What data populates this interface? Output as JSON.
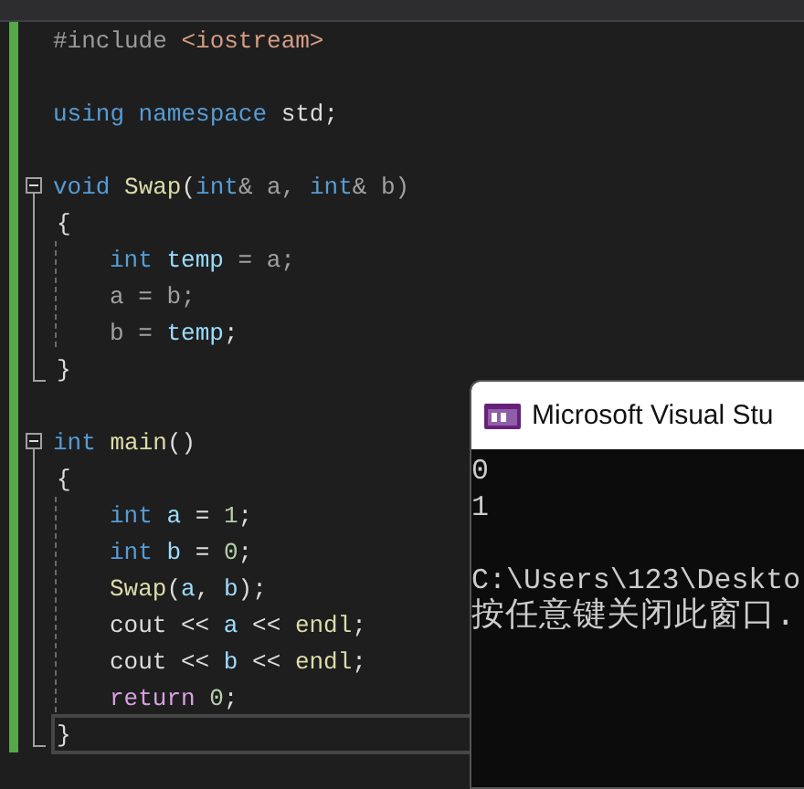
{
  "editor": {
    "lines": [
      {
        "kind": "plain",
        "current": false,
        "tokens": [
          {
            "text": "#include ",
            "kind": "preprocessor"
          },
          {
            "text": "<iostream>",
            "kind": "string"
          }
        ]
      },
      {
        "kind": "blank"
      },
      {
        "kind": "plain",
        "current": false,
        "tokens": [
          {
            "text": "using namespace ",
            "kind": "keyword"
          },
          {
            "text": "std;",
            "kind": "plain"
          }
        ]
      },
      {
        "kind": "blank"
      },
      {
        "kind": "fold",
        "current": false,
        "tokens": [
          {
            "text": "void ",
            "kind": "keyword"
          },
          {
            "text": "Swap",
            "kind": "function"
          },
          {
            "text": "(",
            "kind": "plain"
          },
          {
            "text": "int",
            "kind": "keyword"
          },
          {
            "text": "& a, ",
            "kind": "param"
          },
          {
            "text": "int",
            "kind": "keyword"
          },
          {
            "text": "& b)",
            "kind": "param"
          }
        ]
      },
      {
        "kind": "brace",
        "current": false,
        "tokens": [
          {
            "text": "{",
            "kind": "plain"
          }
        ]
      },
      {
        "kind": "stmt",
        "current": false,
        "tokens": [
          {
            "text": "int ",
            "kind": "keyword"
          },
          {
            "text": "temp",
            "kind": "local"
          },
          {
            "text": " = a;",
            "kind": "param"
          }
        ]
      },
      {
        "kind": "stmt",
        "current": false,
        "tokens": [
          {
            "text": "a = b;",
            "kind": "param"
          }
        ]
      },
      {
        "kind": "stmt",
        "current": false,
        "tokens": [
          {
            "text": "b = ",
            "kind": "param"
          },
          {
            "text": "temp",
            "kind": "local"
          },
          {
            "text": ";",
            "kind": "plain"
          }
        ]
      },
      {
        "kind": "end",
        "current": false,
        "tokens": [
          {
            "text": "}",
            "kind": "plain"
          }
        ]
      },
      {
        "kind": "blank"
      },
      {
        "kind": "fold",
        "current": false,
        "tokens": [
          {
            "text": "int ",
            "kind": "keyword"
          },
          {
            "text": "main",
            "kind": "function"
          },
          {
            "text": "()",
            "kind": "plain"
          }
        ]
      },
      {
        "kind": "brace",
        "current": false,
        "tokens": [
          {
            "text": "{",
            "kind": "plain"
          }
        ]
      },
      {
        "kind": "stmt",
        "current": false,
        "tokens": [
          {
            "text": "int ",
            "kind": "keyword"
          },
          {
            "text": "a",
            "kind": "local"
          },
          {
            "text": " = ",
            "kind": "plain"
          },
          {
            "text": "1",
            "kind": "number"
          },
          {
            "text": ";",
            "kind": "plain"
          }
        ]
      },
      {
        "kind": "stmt",
        "current": false,
        "tokens": [
          {
            "text": "int ",
            "kind": "keyword"
          },
          {
            "text": "b",
            "kind": "local"
          },
          {
            "text": " = ",
            "kind": "plain"
          },
          {
            "text": "0",
            "kind": "number"
          },
          {
            "text": ";",
            "kind": "plain"
          }
        ]
      },
      {
        "kind": "stmt",
        "current": false,
        "tokens": [
          {
            "text": "Swap",
            "kind": "function"
          },
          {
            "text": "(",
            "kind": "plain"
          },
          {
            "text": "a",
            "kind": "local"
          },
          {
            "text": ", ",
            "kind": "plain"
          },
          {
            "text": "b",
            "kind": "local"
          },
          {
            "text": ");",
            "kind": "plain"
          }
        ]
      },
      {
        "kind": "stmt",
        "current": false,
        "tokens": [
          {
            "text": "cout << ",
            "kind": "plain"
          },
          {
            "text": "a",
            "kind": "local"
          },
          {
            "text": " << ",
            "kind": "plain"
          },
          {
            "text": "endl",
            "kind": "function"
          },
          {
            "text": ";",
            "kind": "plain"
          }
        ]
      },
      {
        "kind": "stmt",
        "current": false,
        "tokens": [
          {
            "text": "cout << ",
            "kind": "plain"
          },
          {
            "text": "b",
            "kind": "local"
          },
          {
            "text": " << ",
            "kind": "plain"
          },
          {
            "text": "endl",
            "kind": "function"
          },
          {
            "text": ";",
            "kind": "plain"
          }
        ]
      },
      {
        "kind": "stmt",
        "current": false,
        "tokens": [
          {
            "text": "return ",
            "kind": "control"
          },
          {
            "text": "0",
            "kind": "number"
          },
          {
            "text": ";",
            "kind": "plain"
          }
        ]
      },
      {
        "kind": "end",
        "current": true,
        "tokens": [
          {
            "text": "}",
            "kind": "plain"
          }
        ]
      }
    ]
  },
  "console": {
    "title": "Microsoft Visual Stu",
    "lines": [
      {
        "text": "0",
        "kind": "text"
      },
      {
        "text": "1",
        "kind": "text"
      },
      {
        "kind": "blank"
      },
      {
        "text": "C:\\Users\\123\\Deskto",
        "kind": "text"
      },
      {
        "text": "按任意键关闭此窗口.",
        "kind": "cjk"
      }
    ]
  }
}
